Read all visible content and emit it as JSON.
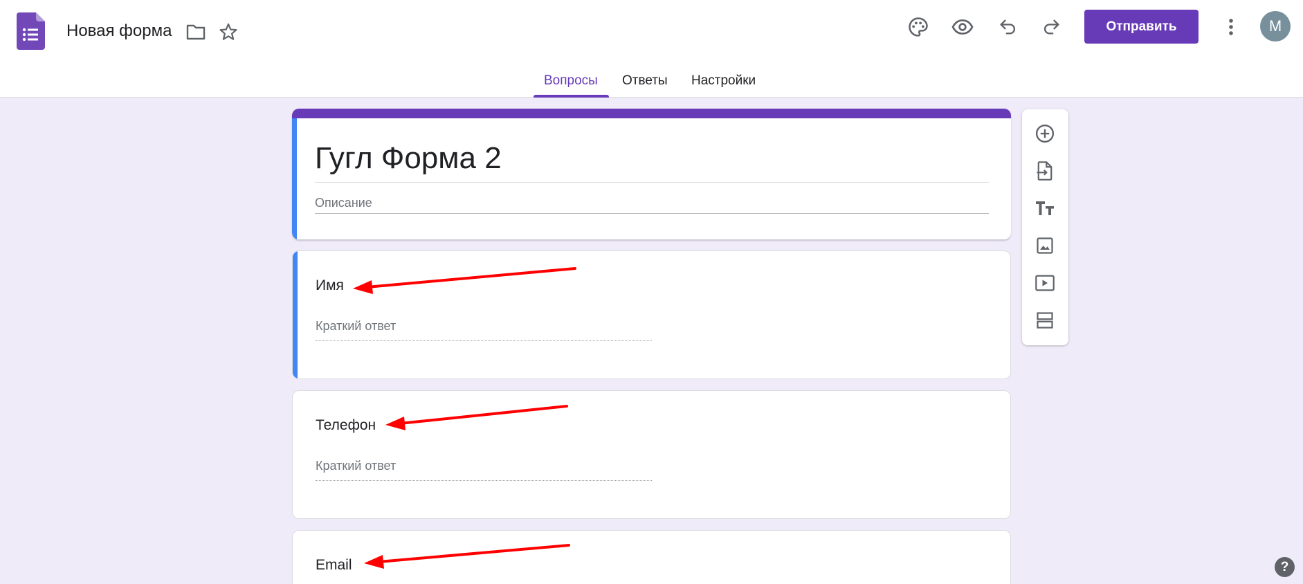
{
  "header": {
    "doc_title": "Новая форма",
    "send_label": "Отправить",
    "avatar_letter": "M",
    "icons": [
      "forms-app-icon",
      "folder-icon",
      "star-icon",
      "palette-icon",
      "eye-icon",
      "undo-icon",
      "redo-icon",
      "more-vert-icon"
    ]
  },
  "tabs": [
    {
      "label": "Вопросы",
      "active": true
    },
    {
      "label": "Ответы",
      "active": false
    },
    {
      "label": "Настройки",
      "active": false
    }
  ],
  "form": {
    "title": "Гугл Форма 2",
    "description_placeholder": "Описание",
    "questions": [
      {
        "label": "Имя",
        "answer_placeholder": "Краткий ответ"
      },
      {
        "label": "Телефон",
        "answer_placeholder": "Краткий ответ"
      },
      {
        "label": "Email"
      }
    ]
  },
  "toolbar": {
    "tools": [
      "add-question-icon",
      "import-questions-icon",
      "add-title-icon",
      "add-image-icon",
      "add-video-icon",
      "add-section-icon"
    ]
  },
  "help": {
    "label": "?"
  },
  "colors": {
    "accent": "#673ab7",
    "background": "#f0ebf8",
    "focus_accent": "#4285f4",
    "annotation_arrows": "#ff0000"
  }
}
